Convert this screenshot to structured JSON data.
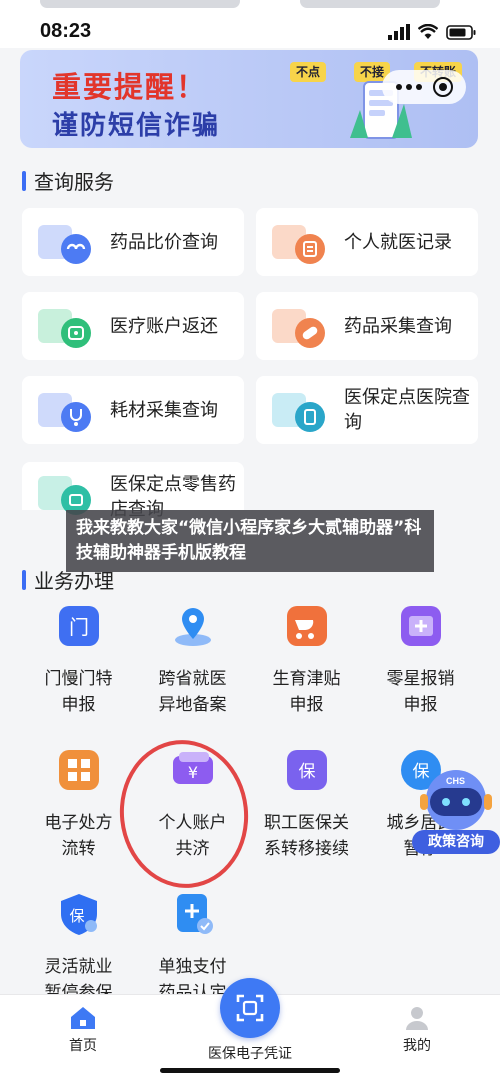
{
  "status": {
    "time": "08:23"
  },
  "banner": {
    "title": "重要提醒！",
    "subtitle": "谨防短信诈骗",
    "tags": [
      "不点",
      "不接",
      "不转账"
    ]
  },
  "query": {
    "title": "查询服务",
    "cards": [
      {
        "label": "药品比价查询",
        "accent": "#4d7bf3"
      },
      {
        "label": "个人就医记录",
        "accent": "#f0834f"
      },
      {
        "label": "医疗账户返还",
        "accent": "#2fbf7a"
      },
      {
        "label": "药品采集查询",
        "accent": "#f0834f"
      },
      {
        "label": "耗材采集查询",
        "accent": "#4d7bf3"
      },
      {
        "label": "医保定点医院查询",
        "accent": "#2aa6c9"
      },
      {
        "label": "医保定点零售药店查询",
        "accent": "#2fbfa5"
      }
    ]
  },
  "business": {
    "title": "业务办理",
    "items": [
      {
        "label": "门慢门特申报",
        "accent": "#3f6ff2",
        "glyph": "门"
      },
      {
        "label": "跨省就医异地备案",
        "accent": "#2f8df2",
        "glyph": "⌂"
      },
      {
        "label": "生育津贴申报",
        "accent": "#f0713c",
        "glyph": "♡"
      },
      {
        "label": "零星报销申报",
        "accent": "#8d5cf0",
        "glyph": "+"
      },
      {
        "label": "电子处方流转",
        "accent": "#f0903c",
        "glyph": "▦"
      },
      {
        "label": "个人账户共济",
        "accent": "#8d5cf0",
        "glyph": "¥"
      },
      {
        "label": "职工医保关系转移接续",
        "accent": "#7a62ee",
        "glyph": "保"
      },
      {
        "label": "城乡居民暂停",
        "accent": "#2f8df2",
        "glyph": "保"
      },
      {
        "label": "灵活就业暂停参保",
        "accent": "#2f6ff2",
        "glyph": "保"
      },
      {
        "label": "单独支付药品认定",
        "accent": "#2f8df2",
        "glyph": "+"
      }
    ]
  },
  "overlay": {
    "text": "我来教教大家“微信小程序家乡大贰辅助器”科技辅助神器手机版教程"
  },
  "chs_badge": {
    "logo": "CHS",
    "label": "政策咨询"
  },
  "tabbar": {
    "home": "首页",
    "center": "医保电子凭证",
    "mine": "我的"
  }
}
